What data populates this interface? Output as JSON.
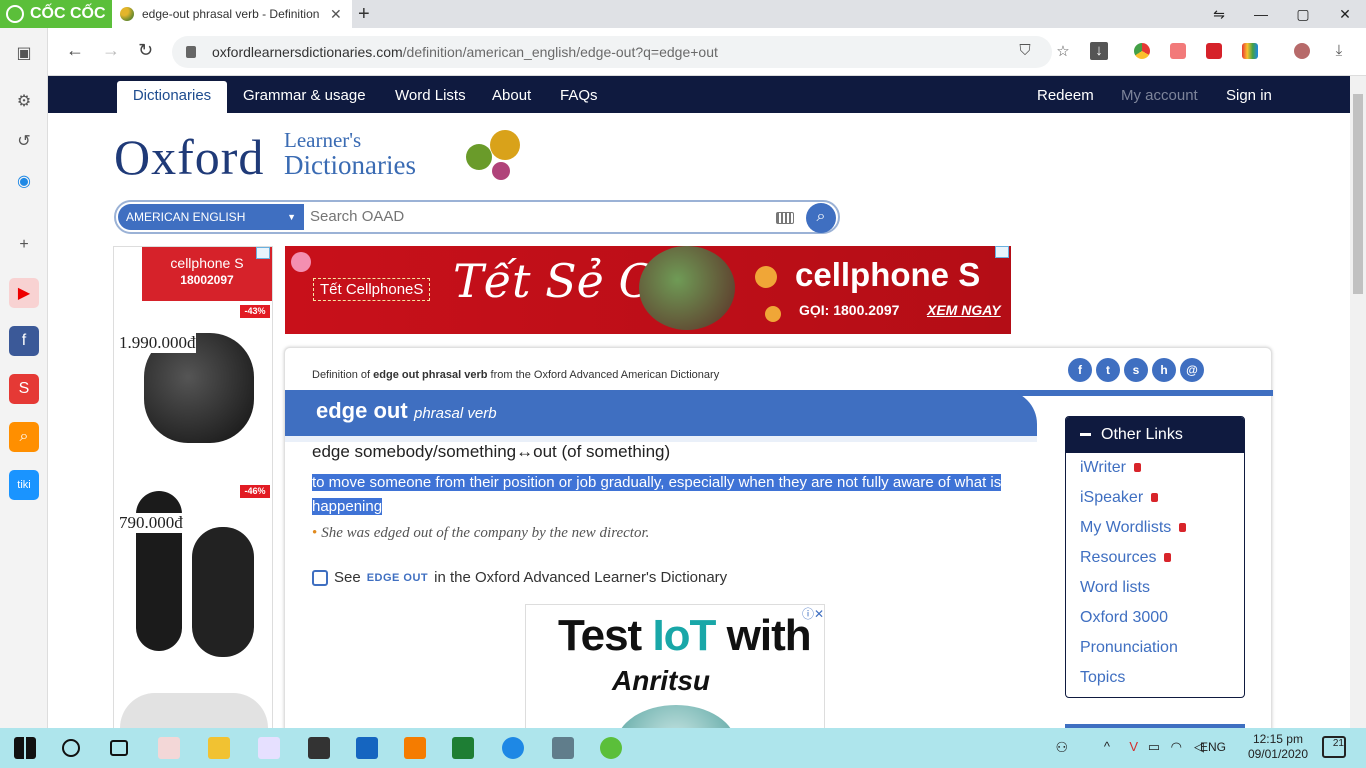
{
  "browser": {
    "brand": "CỐC CỐC",
    "tab_title": "edge-out phrasal verb - Definition",
    "new_tab": "+",
    "url_host": "oxfordlearnersdictionaries.com",
    "url_path": "/definition/american_english/edge-out?q=edge+out",
    "window_controls": [
      "⇋",
      "—",
      "▢",
      "✕"
    ]
  },
  "nav": {
    "dictionaries": "Dictionaries",
    "grammar": "Grammar & usage",
    "word_lists": "Word Lists",
    "about": "About",
    "faqs": "FAQs",
    "redeem": "Redeem",
    "my_account": "My account",
    "sign_in": "Sign in"
  },
  "logo": {
    "oxford": "Oxford",
    "learners": "Learner's",
    "dictionaries": "Dictionaries"
  },
  "search": {
    "dictionary_select": "AMERICAN ENGLISH",
    "placeholder": "Search OAAD"
  },
  "left_ad": {
    "brand": "cellphone S",
    "phone": "18002097",
    "items": [
      {
        "discount": "-43%",
        "price": "1.990.000đ"
      },
      {
        "discount": "-46%",
        "price": "790.000đ"
      }
    ]
  },
  "banner": {
    "tag": "Tết CellphoneS",
    "slogan": "Tết Sẻ Chia",
    "brand": "cellphone S",
    "phone": "GỌI: 1800.2097",
    "cta": "XEM NGAY"
  },
  "entry": {
    "label_prefix": "Definition of",
    "label_word": "edge out phrasal verb",
    "label_suffix": "from the Oxford Advanced American Dictionary",
    "headword": "edge out",
    "pos": "phrasal verb",
    "pattern": "edge somebody/something↔out (of something)",
    "definition": "to move someone from their position or job gradually, especially when they are not fully aware of what is happening",
    "example": "She was edged out of the company by the new director.",
    "see_prefix": "See",
    "see_link": "EDGE OUT",
    "see_suffix": "in the Oxford Advanced Learner's Dictionary"
  },
  "social": [
    "f",
    "t",
    "s",
    "h",
    "@"
  ],
  "ad2": {
    "line1_a": "Test ",
    "line1_iot": "IoT",
    "line1_b": " with",
    "line2": "Anritsu",
    "close": "ⓘ✕"
  },
  "other_links": {
    "title": "Other Links",
    "items": [
      {
        "label": "iWriter",
        "locked": true
      },
      {
        "label": "iSpeaker",
        "locked": true
      },
      {
        "label": "My Wordlists",
        "locked": true
      },
      {
        "label": "Resources",
        "locked": true
      },
      {
        "label": "Word lists",
        "locked": false
      },
      {
        "label": "Oxford 3000",
        "locked": false
      },
      {
        "label": "Pronunciation",
        "locked": false
      },
      {
        "label": "Topics",
        "locked": false
      }
    ]
  },
  "taskbar": {
    "lang": "ENG",
    "time": "12:15 pm",
    "date": "09/01/2020",
    "notifications": "21"
  },
  "colors": {
    "oxford_navy": "#0f1a3f",
    "oxford_blue": "#3f6fc1",
    "highlight": "#3f73d6",
    "coccoc_green": "#5bbf3a",
    "ad_red": "#d6222a"
  }
}
